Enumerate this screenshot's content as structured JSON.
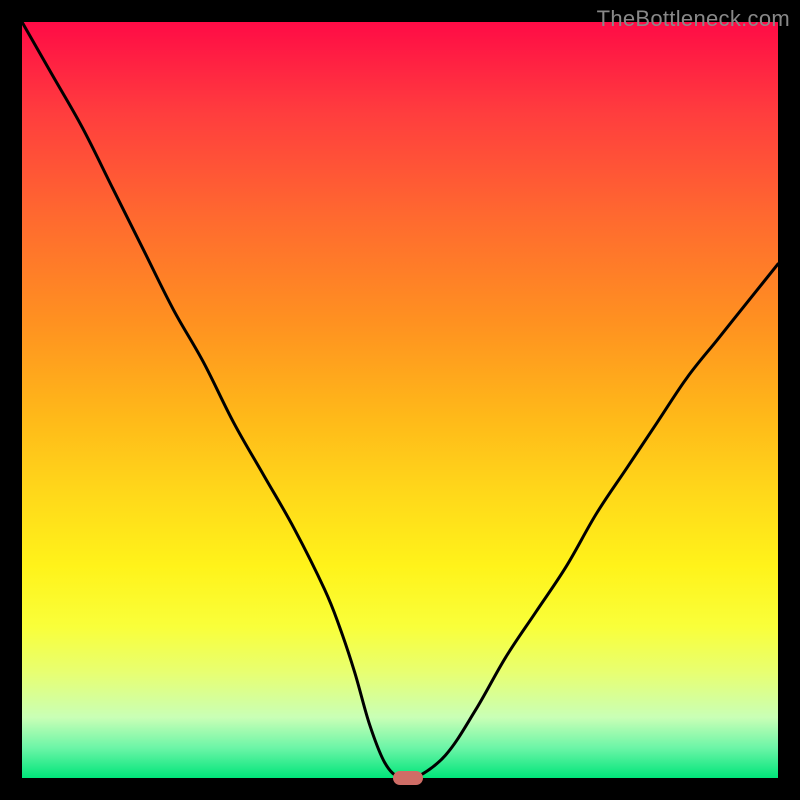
{
  "watermark": "TheBottleneck.com",
  "chart_data": {
    "type": "line",
    "title": "",
    "xlabel": "",
    "ylabel": "",
    "xlim": [
      0,
      100
    ],
    "ylim": [
      0,
      100
    ],
    "series": [
      {
        "name": "curve",
        "x": [
          0,
          4,
          8,
          12,
          16,
          20,
          24,
          28,
          32,
          36,
          40,
          42,
          44,
          46,
          48,
          50,
          52,
          56,
          60,
          64,
          68,
          72,
          76,
          80,
          84,
          88,
          92,
          96,
          100
        ],
        "values": [
          100,
          93,
          86,
          78,
          70,
          62,
          55,
          47,
          40,
          33,
          25,
          20,
          14,
          7,
          2,
          0,
          0,
          3,
          9,
          16,
          22,
          28,
          35,
          41,
          47,
          53,
          58,
          63,
          68
        ]
      }
    ],
    "marker": {
      "x": 51,
      "y": 0
    }
  },
  "colors": {
    "curve": "#000000",
    "marker": "#cf6d66",
    "background_top": "#ff0b46",
    "background_bottom": "#00e57a",
    "frame": "#000000"
  }
}
